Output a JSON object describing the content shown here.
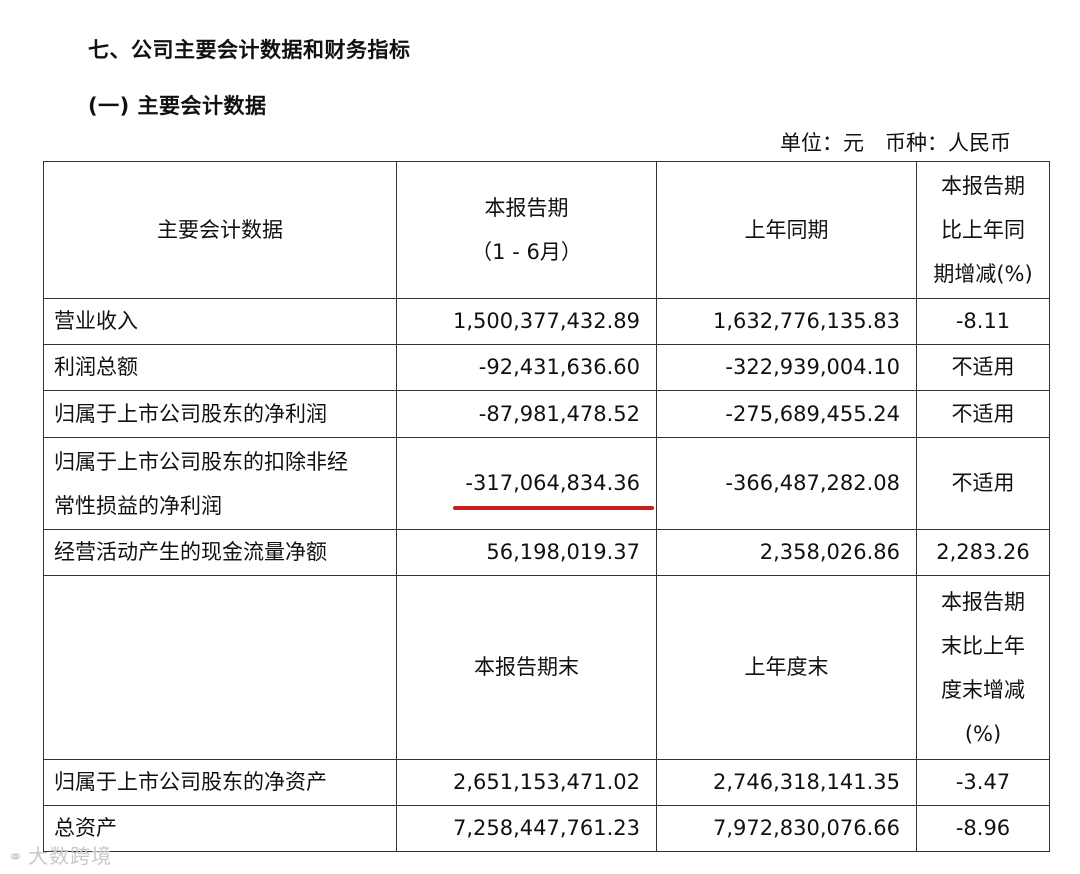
{
  "section_title": "七、公司主要会计数据和财务指标",
  "subsection_title": "(一) 主要会计数据",
  "unit_note": "单位：元　币种：人民币",
  "header1": {
    "col1": "主要会计数据",
    "col2_line1": "本报告期",
    "col2_line2": "（1 - 6月）",
    "col3": "上年同期",
    "col4_line1": "本报告期",
    "col4_line2": "比上年同",
    "col4_line3": "期增减(%)"
  },
  "rows1": [
    {
      "label": "营业收入",
      "current": "1,500,377,432.89",
      "prior": "1,632,776,135.83",
      "change": "-8.11"
    },
    {
      "label": "利润总额",
      "current": "-92,431,636.60",
      "prior": "-322,939,004.10",
      "change": "不适用"
    },
    {
      "label": "归属于上市公司股东的净利润",
      "current": "-87,981,478.52",
      "prior": "-275,689,455.24",
      "change": "不适用"
    },
    {
      "label_line1": "归属于上市公司股东的扣除非经",
      "label_line2": "常性损益的净利润",
      "current": "-317,064,834.36",
      "prior": "-366,487,282.08",
      "change": "不适用"
    },
    {
      "label": "经营活动产生的现金流量净额",
      "current": "56,198,019.37",
      "prior": "2,358,026.86",
      "change": "2,283.26"
    }
  ],
  "header2": {
    "col2": "本报告期末",
    "col3": "上年度末",
    "col4_line1": "本报告期",
    "col4_line2": "末比上年",
    "col4_line3": "度末增减",
    "col4_line4": "(%)"
  },
  "rows2": [
    {
      "label": "归属于上市公司股东的净资产",
      "current": "2,651,153,471.02",
      "prior": "2,746,318,141.35",
      "change": "-3.47"
    },
    {
      "label": "总资产",
      "current": "7,258,447,761.23",
      "prior": "7,972,830,076.66",
      "change": "-8.96"
    }
  ],
  "watermark": "大数跨境",
  "colors": {
    "underline_highlight": "#c8201d"
  }
}
